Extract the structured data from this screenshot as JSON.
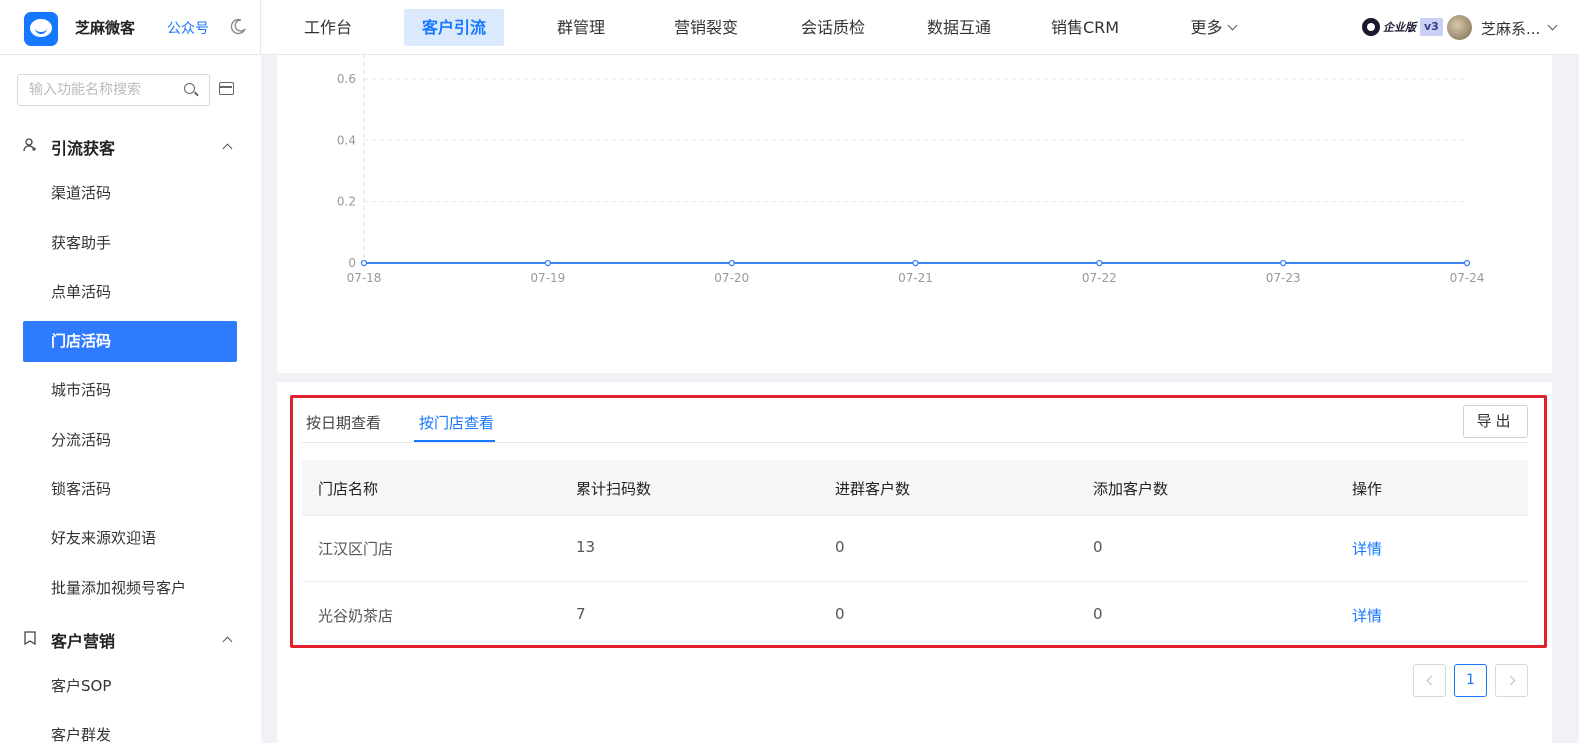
{
  "topbar": {
    "brand": "芝麻微客",
    "official_account": "公众号",
    "nav": [
      {
        "label": "工作台",
        "active": false
      },
      {
        "label": "客户引流",
        "active": true
      },
      {
        "label": "群管理",
        "active": false
      },
      {
        "label": "营销裂变",
        "active": false
      },
      {
        "label": "会话质检",
        "active": false
      },
      {
        "label": "数据互通",
        "active": false
      },
      {
        "label": "销售CRM",
        "active": false
      },
      {
        "label": "更多",
        "active": false
      }
    ],
    "edition": "企业版",
    "version": "v3",
    "username": "芝麻系..."
  },
  "sidebar": {
    "search_placeholder": "输入功能名称搜索",
    "groups": [
      {
        "title": "引流获客",
        "items": [
          "渠道活码",
          "获客助手",
          "点单活码",
          "门店活码",
          "城市活码",
          "分流活码",
          "锁客活码",
          "好友来源欢迎语",
          "批量添加视频号客户"
        ]
      },
      {
        "title": "客户营销",
        "items": [
          "客户SOP",
          "客户群发"
        ]
      }
    ],
    "active_item": "门店活码"
  },
  "chart_data": {
    "type": "line",
    "x": [
      "07-18",
      "07-19",
      "07-20",
      "07-21",
      "07-22",
      "07-23",
      "07-24"
    ],
    "y_ticks": [
      "0",
      "0.2",
      "0.4",
      "0.6"
    ],
    "ylim": [
      0,
      0.6
    ],
    "series": [
      {
        "values": [
          0,
          0,
          0,
          0,
          0,
          0,
          0
        ],
        "color": "#3b82f6"
      }
    ],
    "grid": "horizontal-dashed"
  },
  "stats": {
    "tabs": [
      "按日期查看",
      "按门店查看"
    ],
    "active_tab": "按门店查看",
    "export_label": "导出",
    "columns": [
      "门店名称",
      "累计扫码数",
      "进群客户数",
      "添加客户数",
      "操作"
    ],
    "rows": [
      {
        "name": "江汉区门店",
        "scans": "13",
        "group_customers": "0",
        "added_customers": "0",
        "action": "详情"
      },
      {
        "name": "光谷奶茶店",
        "scans": "7",
        "group_customers": "0",
        "added_customers": "0",
        "action": "详情"
      }
    ]
  },
  "pagination": {
    "current": "1"
  },
  "colors": {
    "accent": "#1677ff",
    "highlight": "#e0202a"
  }
}
